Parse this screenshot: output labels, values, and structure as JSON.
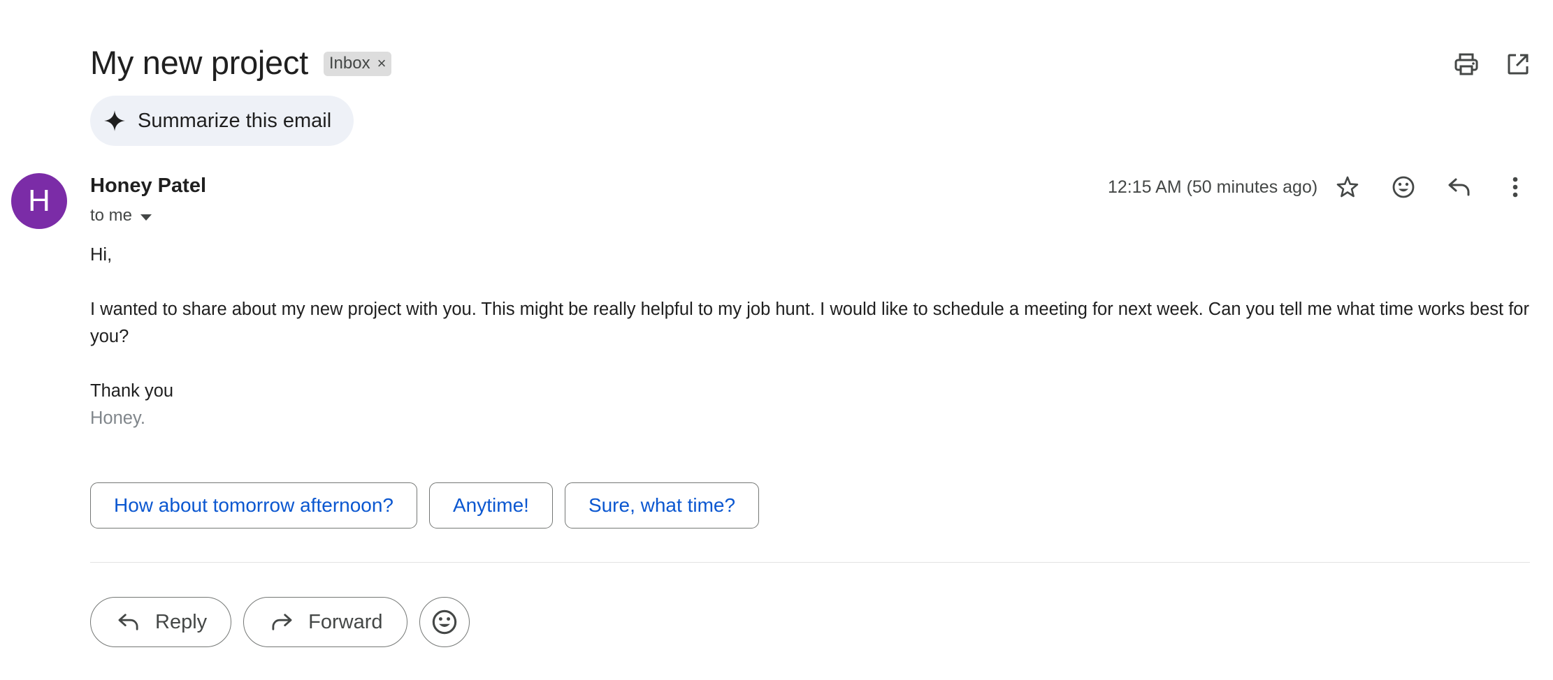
{
  "email": {
    "subject": "My new project",
    "label": "Inbox",
    "label_remove": "×",
    "summarize_label": "Summarize this email",
    "sender": {
      "name": "Honey Patel",
      "initial": "H",
      "avatar_color": "#7b2ca7"
    },
    "recipient_label": "to me",
    "timestamp": "12:15 AM (50 minutes ago)",
    "body": {
      "greeting": "Hi,",
      "paragraph": "I wanted to share about my new project with you. This might be really helpful to my job hunt. I would like to schedule a meeting for next week. Can you tell me what time works best for you?",
      "closing": "Thank you",
      "signature": "Honey."
    }
  },
  "smart_replies": [
    "How about tomorrow afternoon?",
    "Anytime!",
    "Sure, what time?"
  ],
  "actions": {
    "reply_label": "Reply",
    "forward_label": "Forward"
  },
  "icons": {
    "print": "print-icon",
    "open_new_window": "open-in-new-icon",
    "sparkle": "sparkle-icon",
    "star": "star-icon",
    "emoji": "emoji-icon",
    "reply": "reply-icon",
    "more": "more-vert-icon",
    "forward": "forward-icon",
    "dropdown": "caret-down-icon"
  },
  "colors": {
    "link_blue": "#0b57d0",
    "summarize_bg": "#eef1f7",
    "label_bg": "#dddddd"
  }
}
